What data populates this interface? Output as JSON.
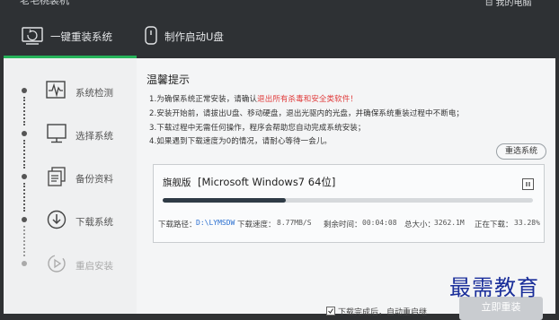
{
  "app": {
    "title": "老毛桃装机",
    "corner_action": "⊟ 我的电脑"
  },
  "tabs": [
    {
      "label": "一键重装系统",
      "active": true
    },
    {
      "label": "制作启动U盘",
      "active": false
    }
  ],
  "steps": [
    {
      "label": "系统检测",
      "icon": "pulse-icon"
    },
    {
      "label": "选择系统",
      "icon": "monitor-icon"
    },
    {
      "label": "备份资料",
      "icon": "documents-icon"
    },
    {
      "label": "下载系统",
      "icon": "download-icon"
    },
    {
      "label": "重启安装",
      "icon": "restart-icon"
    }
  ],
  "main": {
    "heading": "温馨提示",
    "notes": [
      {
        "before": "1.为确保系统正常安装，请确认",
        "red": "退出所有杀毒和安全类软件！",
        "after": ""
      },
      {
        "before": "2.安装开始前，请拔出U盘、移动硬盘，退出光驱内的光盘，并确保系统重装过程中不断电；",
        "red": "",
        "after": ""
      },
      {
        "before": "3.下载过程中无需任何操作，程序会帮助您自动完成系统安装；",
        "red": "",
        "after": ""
      },
      {
        "before": "4.如果遇到下载速度为0的情况，请耐心等待一会儿。",
        "red": "",
        "after": ""
      }
    ],
    "reselect_label": "重选系统"
  },
  "download": {
    "edition": "旗舰版",
    "os_name": "[Microsoft Windows7 64位]",
    "progress": 0.3328,
    "path_label": "下载路径：",
    "path_value": "D:\\LYMSDW",
    "speed_label": "下载速度：",
    "speed_value": "8.77MB/S",
    "remaining_label": "剩余时间：",
    "remaining_value": "00:04:08",
    "size_label": "总大小：",
    "size_value": "3262.1M",
    "status_label": "正在下载：",
    "status_value": "33.28%"
  },
  "footer": {
    "auto_restart_label": "下载完成后，自动重启继",
    "install_label": "立即重装"
  },
  "watermark": "最需教育",
  "colors": {
    "accent": "#26b35a",
    "header": "#2e3134",
    "warning": "#e03b3b"
  }
}
